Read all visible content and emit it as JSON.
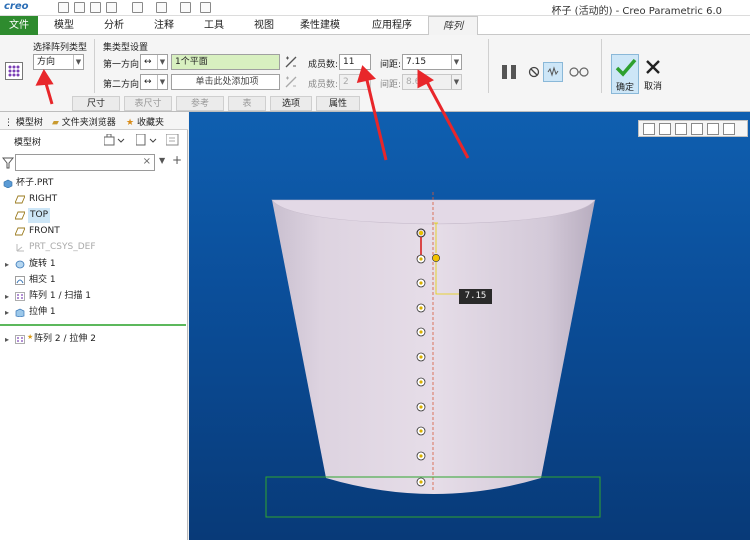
{
  "app": {
    "logo": "creo",
    "window_title": "杯子 (活动的) - Creo Parametric 6.0"
  },
  "ribbon_tabs": {
    "file": "文件",
    "model": "模型",
    "analysis": "分析",
    "annotate": "注释",
    "tools": "工具",
    "view": "视图",
    "flexible": "柔性建模",
    "apps": "应用程序",
    "pattern": "阵列"
  },
  "pattern_panel": {
    "type_label": "选择阵列类型",
    "type_value": "方向",
    "set_type_label": "集类型设置",
    "dir1_label": "第一方向:",
    "dir1_ref": "1个平面",
    "dir2_label": "第二方向:",
    "dir2_ref": "单击此处添加项",
    "members_label": "成员数:",
    "members1_value": "11",
    "members2_value": "2",
    "spacing_label": "间距:",
    "spacing1_value": "7.15",
    "spacing2_value": "8.62"
  },
  "ribbon_subtabs": {
    "dims": "尺寸",
    "table_dims": "表尺寸",
    "refs": "参考",
    "table": "表",
    "options": "选项",
    "properties": "属性"
  },
  "actions": {
    "ok": "确定",
    "cancel": "取消"
  },
  "left_panel": {
    "tab_model_tree": "模型树",
    "tab_folder": "文件夹浏览器",
    "tab_favorites": "收藏夹",
    "tree_title": "模型树",
    "items": [
      {
        "label": "杯子.PRT"
      },
      {
        "label": "RIGHT"
      },
      {
        "label": "TOP"
      },
      {
        "label": "FRONT"
      },
      {
        "label": "PRT_CSYS_DEF"
      },
      {
        "label": "旋转 1"
      },
      {
        "label": "相交 1"
      },
      {
        "label": "阵列 1 / 扫描 1"
      },
      {
        "label": "拉伸 1"
      },
      {
        "label": "阵列 2 / 拉伸 2"
      }
    ]
  },
  "viewport": {
    "dimension_tag": "7.15"
  },
  "colors": {
    "file_tab": "#2e8b2e",
    "viewport_bg": "#0b4f9b",
    "highlight": "#cde6f7",
    "annotation_arrow": "#e8262a"
  }
}
